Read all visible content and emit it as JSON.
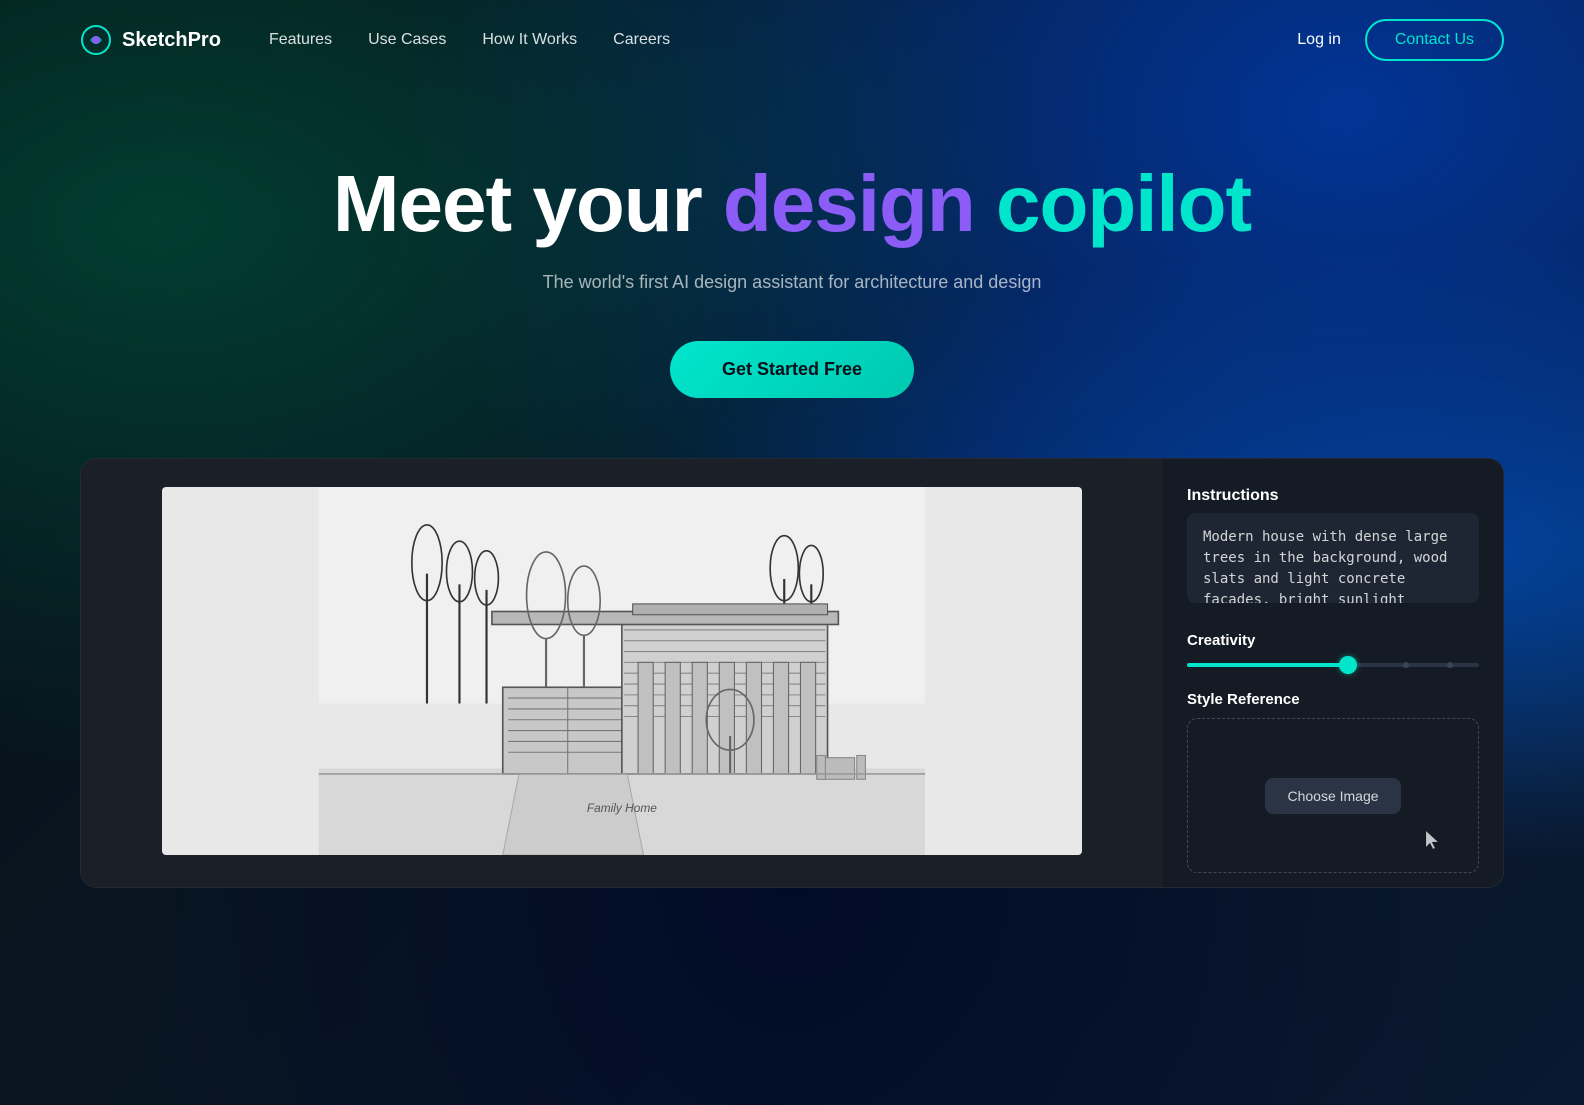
{
  "brand": {
    "name": "SketchPro",
    "logo_text": "SketchPro"
  },
  "nav": {
    "links": [
      {
        "id": "features",
        "label": "Features"
      },
      {
        "id": "use-cases",
        "label": "Use Cases"
      },
      {
        "id": "how-it-works",
        "label": "How It Works"
      },
      {
        "id": "careers",
        "label": "Careers"
      }
    ],
    "login_label": "Log in",
    "contact_label": "Contact Us"
  },
  "hero": {
    "title_part1": "Meet your ",
    "title_part2": "design",
    "title_part3": " copilot",
    "subtitle": "The world's first AI design assistant for architecture and design",
    "cta_label": "Get Started Free"
  },
  "demo": {
    "instructions_label": "Instructions",
    "instructions_placeholder": "Modern house with dense large trees in the background, wood slats and light concrete facades, bright sunlight",
    "instructions_value": "Modern house with dense large trees in the background, wood slats and light concrete facades, bright sunlight",
    "creativity_label": "Creativity",
    "slider_value": 55,
    "style_ref_label": "Style Reference",
    "choose_image_label": "Choose Image",
    "sketch_label": "Family Home"
  }
}
